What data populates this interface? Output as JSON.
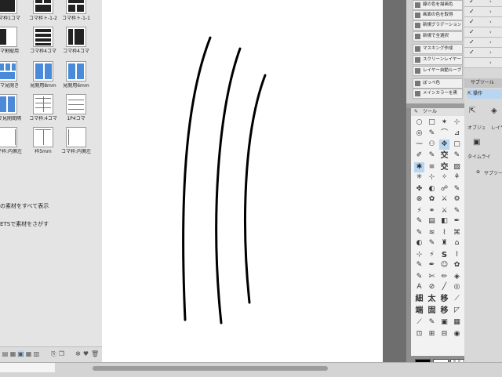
{
  "materials": {
    "thumb_labels": [
      [
        "コマ枠1コマ",
        "コマ枠ト-1-2",
        "コマ枠ト-1-1"
      ],
      [
        "コマ割縦用",
        "コマ枠4コマ",
        "コマ枠4コマ"
      ],
      [
        "コマ見開き",
        "見開用8mm",
        "見開用6mm"
      ],
      [
        "コマ見開間隔",
        "コマ枠:4コマ",
        "1P4コマ"
      ],
      [
        "コマ枠:内側左",
        "枠5mm",
        "コマ枠:内側左"
      ]
    ],
    "show_all": "の素材をすべて表示",
    "find_assets": "ETSで素材をさがす"
  },
  "auto_actions": {
    "items": [
      "線の色を描画色",
      "画面の色を取得",
      "新規グラデーション",
      "新規で全選択",
      "マスキング作成",
      "スクリーンレイヤー",
      "レイヤー自動ループ",
      "ぼっぺ色",
      "メインカラーを黒"
    ]
  },
  "tool_panel": {
    "header": "ツール",
    "glyph_tools": [
      "交",
      "細",
      "太",
      "移",
      "端",
      "固",
      "S"
    ]
  },
  "right_panel": {
    "sub_tool_tab": "サブツール",
    "operation": "操作",
    "object_tab": "オブジェクト",
    "layer_tab": "レイヤー",
    "timeline_tab": "タイムライン",
    "sub_tool_add": "サブツー"
  },
  "colors": {
    "main": "#000000",
    "sub": "#ffffff",
    "selection": "#b8d6f2"
  }
}
